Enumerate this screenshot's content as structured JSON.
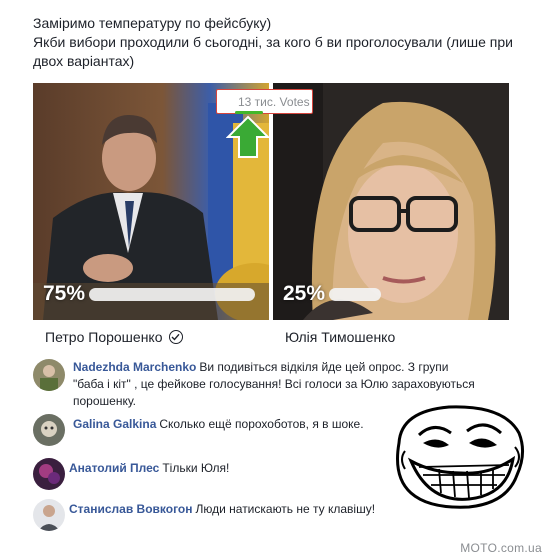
{
  "post": {
    "line1": "Заміримо температуру по фейсбуку)",
    "line2": "Якби вибори проходили б сьогодні, за кого б ви проголосували (лише при двох варіантах)"
  },
  "poll": {
    "votes_label": "13 тис. Votes",
    "options": [
      {
        "name": "Петро Порошенко",
        "percent": "75%",
        "share": 0.75,
        "selected": true
      },
      {
        "name": "Юлія Тимошенко",
        "percent": "25%",
        "share": 0.25,
        "selected": false
      }
    ]
  },
  "comments": [
    {
      "author": "Nadezhda Marchenko",
      "text": "Ви подивіться відкіля йде цей опрос. З групи \"баба і кіт\" , це фейкове голосування! Всі голоси за Юлю зараховуються порошенку."
    },
    {
      "author": "Galina Galkina",
      "text": "Сколько ещё порохоботов, я в шоке."
    },
    {
      "author": "Анатолий Плес",
      "text": "Тільки Юля!"
    },
    {
      "author": "Станислав Вовкогон",
      "text": "Люди натискають не ту клавішу!"
    }
  ],
  "watermark": "MOTO.com.ua",
  "colors": {
    "author": "#385898",
    "badge_border": "#d6453d",
    "arrow": "#3aaa35"
  },
  "icons": {
    "selected_check": "check-circle-icon",
    "up_arrow": "green-arrow-icon",
    "meme": "trollface-icon"
  }
}
